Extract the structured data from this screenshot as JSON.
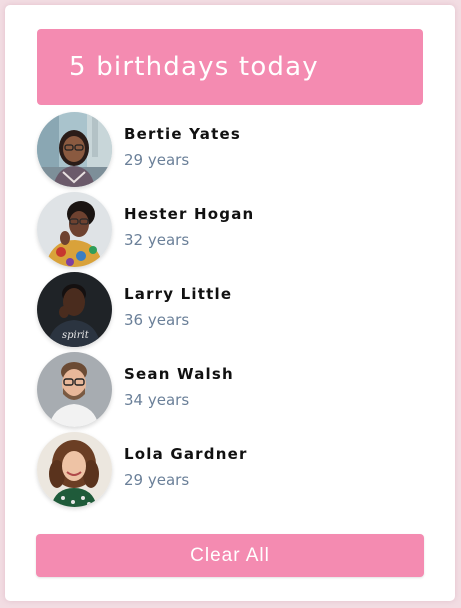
{
  "header": {
    "title": "5 birthdays today"
  },
  "people": [
    {
      "name": "Bertie Yates",
      "age": "29 years",
      "avatar": "woman-glasses-street-photo"
    },
    {
      "name": "Hester Hogan",
      "age": "32 years",
      "avatar": "woman-glasses-floral-photo"
    },
    {
      "name": "Larry Little",
      "age": "36 years",
      "avatar": "man-dark-background-photo"
    },
    {
      "name": "Sean Walsh",
      "age": "34 years",
      "avatar": "man-glasses-beard-photo"
    },
    {
      "name": "Lola Gardner",
      "age": "29 years",
      "avatar": "woman-curly-hair-photo"
    }
  ],
  "actions": {
    "clear_label": "Clear All"
  },
  "colors": {
    "accent": "#f48bb1",
    "page_background": "#f2dde3",
    "age_text": "#6b8099"
  }
}
